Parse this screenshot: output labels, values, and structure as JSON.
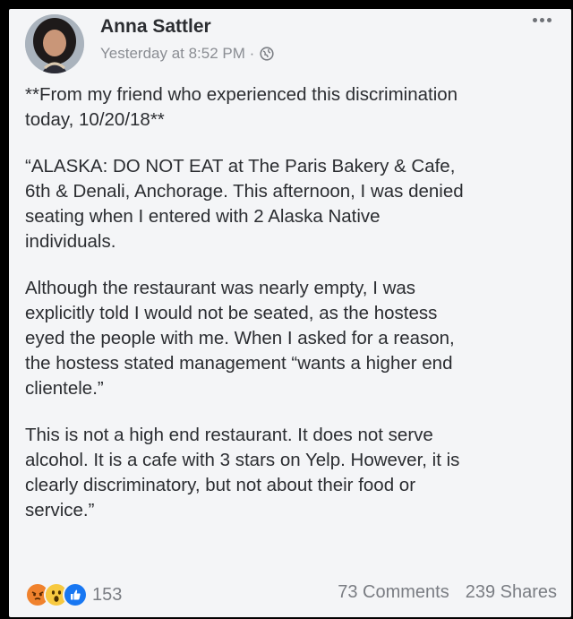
{
  "post": {
    "author": "Anna Sattler",
    "timestamp": "Yesterday at 8:52 PM · ",
    "privacy_icon": "globe-icon",
    "menu_icon": "more-options-icon",
    "paragraphs": [
      "**From my friend who experienced this discrimination\ntoday, 10/20/18**",
      "“ALASKA: DO NOT EAT at The Paris Bakery & Cafe,\n6th & Denali, Anchorage. This afternoon, I was denied\nseating when I entered with 2 Alaska Native\nindividuals.",
      "Although the restaurant was nearly empty, I was\nexplicitly told I would not be seated, as the hostess\neyed the people with me. When I asked for a reason,\nthe hostess stated management “wants a higher end\nclientele.”",
      "This is not a high end restaurant. It does not serve\nalcohol. It is a cafe with 3 stars on Yelp. However, it is\nclearly discriminatory, but not about their food or\nservice.”"
    ],
    "reactions": {
      "icons": [
        "angry-reaction-icon",
        "wow-reaction-icon",
        "like-reaction-icon"
      ],
      "count": "153"
    },
    "comments": "73 Comments",
    "shares": "239 Shares"
  },
  "colors": {
    "card_background": "#f4f5f7",
    "angry": "#f0822d",
    "wow": "#f7c940",
    "like": "#1877f2"
  }
}
